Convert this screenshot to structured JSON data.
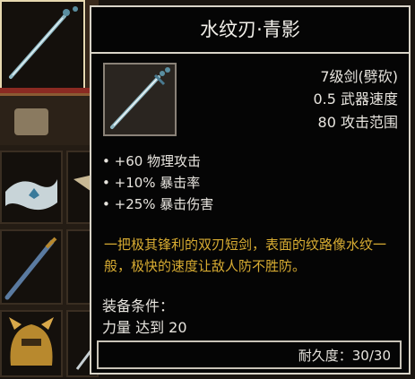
{
  "tooltip": {
    "title": "水纹刃·青影",
    "weapon_class": "7级剑(劈砍)",
    "weapon_speed": "0.5 武器速度",
    "attack_range": "80 攻击范围",
    "stats": [
      "+60 物理攻击",
      "+10% 暴击率",
      "+25% 暴击伤害"
    ],
    "description": "一把极其锋利的双刃短剑，表面的纹路像水纹一般，极快的速度让敌人防不胜防。",
    "requirements_label": "装备条件：",
    "requirement": "力量 达到 20",
    "durability": "耐久度：30/30"
  },
  "colors": {
    "title_text": "#f2f0ea",
    "description_text": "#d8ac32",
    "body_text": "#e8e5df",
    "border": "#d9d4c8",
    "background": "#050505"
  },
  "icons": {
    "item": "sword-icon",
    "inventory": [
      "sword-icon",
      "map-icon",
      "cloth-icon",
      "shield-icon",
      "spear-icon",
      "helmet-icon",
      "sword-icon"
    ]
  }
}
